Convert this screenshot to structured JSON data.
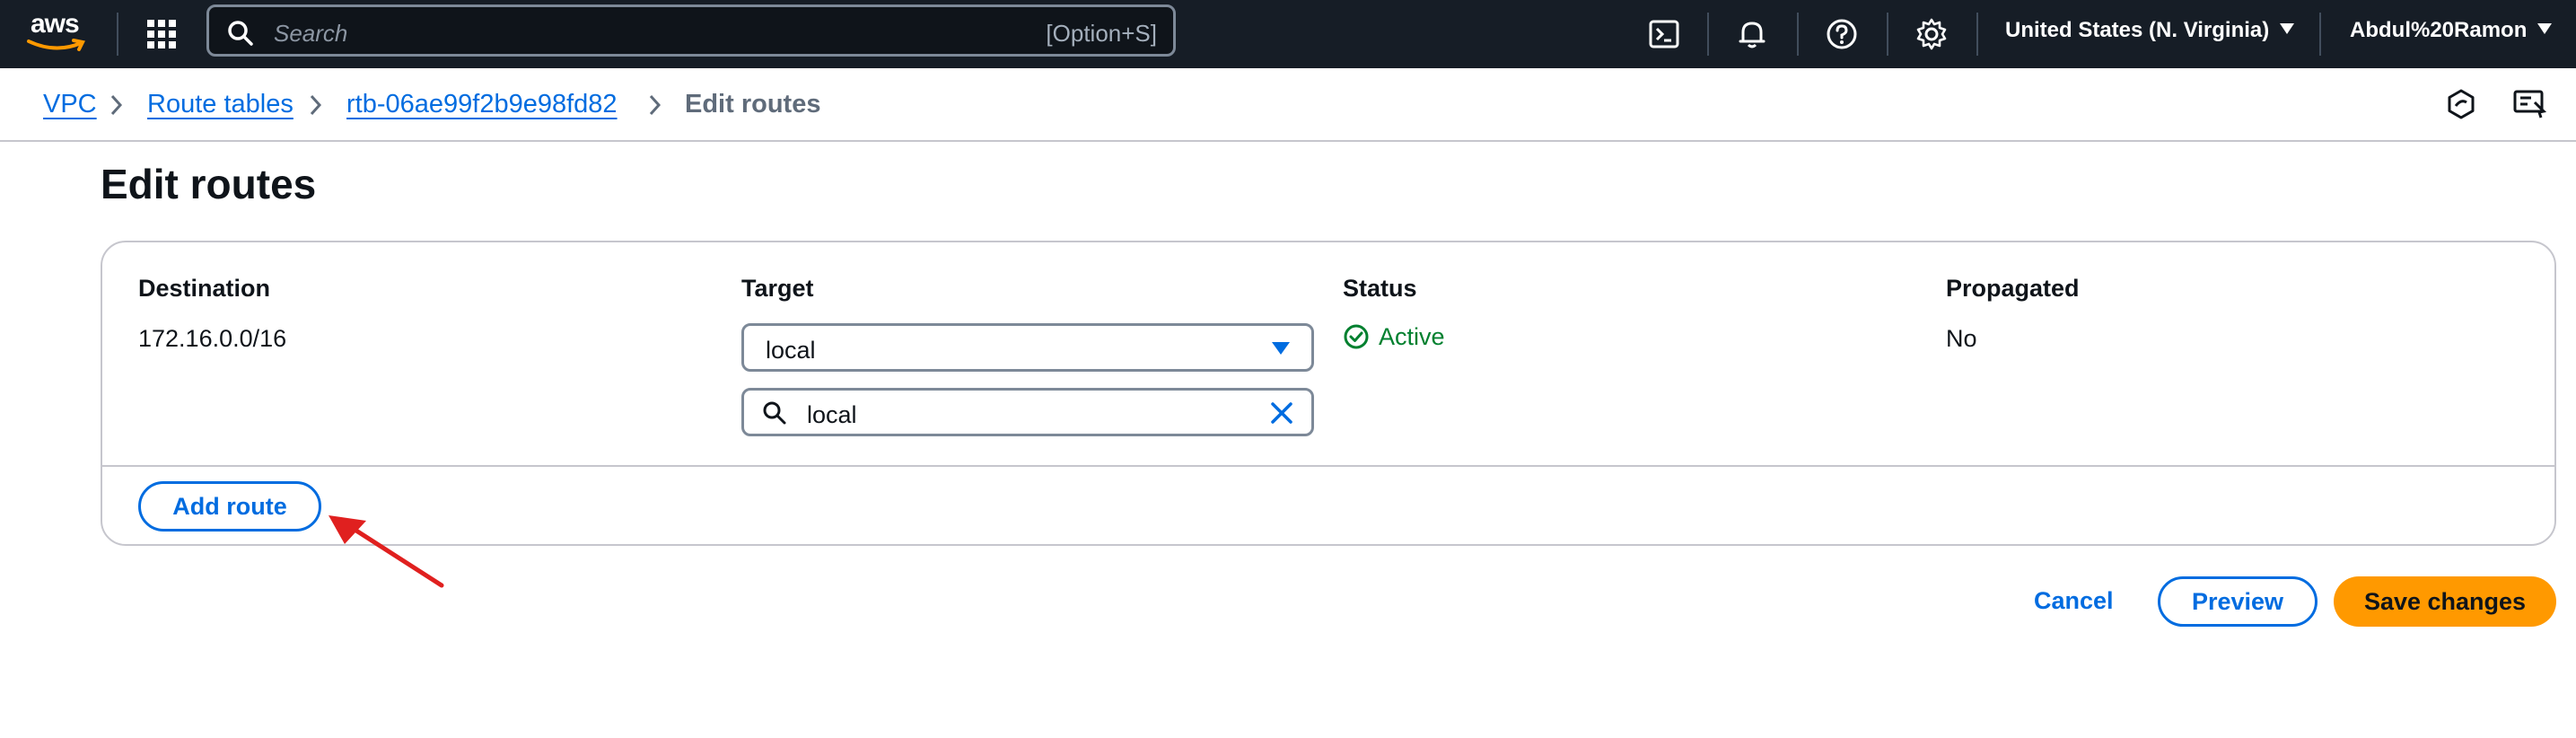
{
  "topnav": {
    "logo_text": "aws",
    "search_placeholder": "Search",
    "search_shortcut": "[Option+S]",
    "icons": [
      "cloudshell-icon",
      "bell-icon",
      "help-icon",
      "gear-icon"
    ],
    "region": "United States (N. Virginia)",
    "user": "Abdul%20Ramon"
  },
  "breadcrumb": {
    "items": [
      "VPC",
      "Route tables",
      "rtb-06ae99f2b9e98fd82"
    ],
    "current": "Edit routes"
  },
  "page": {
    "title": "Edit routes"
  },
  "routes": {
    "columns": {
      "destination": "Destination",
      "target": "Target",
      "status": "Status",
      "propagated": "Propagated"
    },
    "rows": [
      {
        "destination": "172.16.0.0/16",
        "target_select": "local",
        "target_filter": "local",
        "status": "Active",
        "propagated": "No"
      }
    ],
    "add_route_label": "Add route"
  },
  "footer": {
    "cancel_label": "Cancel",
    "preview_label": "Preview",
    "save_label": "Save changes"
  },
  "colors": {
    "nav_bg": "#161d26",
    "link": "#006ce0",
    "status_ok": "#00802f",
    "primary": "#ff9900",
    "annotation_arrow": "#e0201f"
  }
}
